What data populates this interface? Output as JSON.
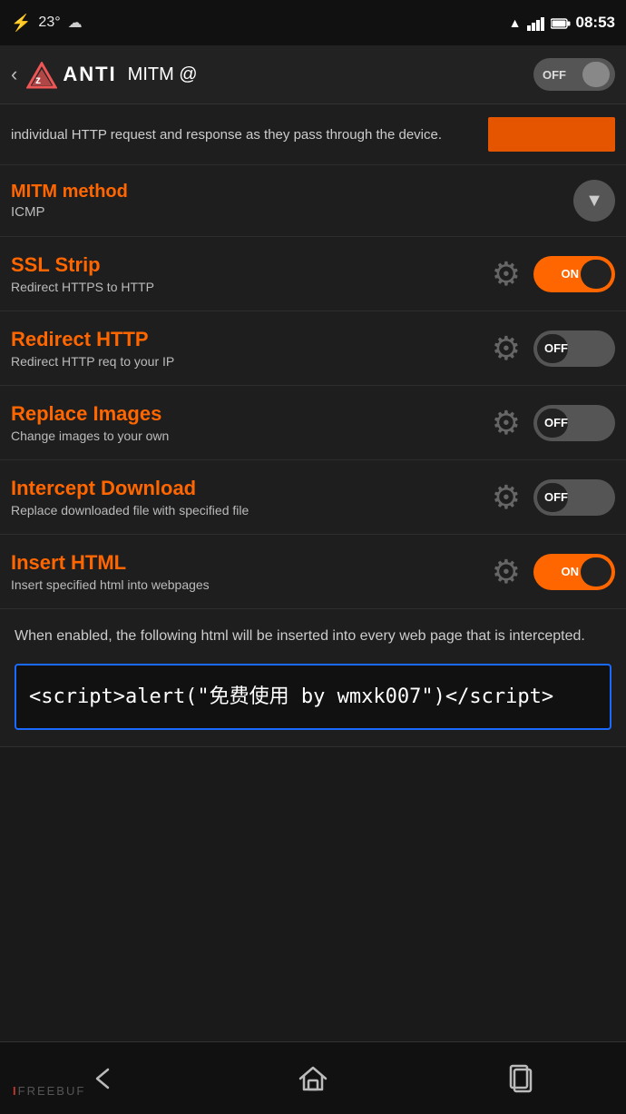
{
  "statusBar": {
    "icon": "⚡",
    "temp": "23°",
    "cloud": "☁",
    "wifi": "▲",
    "signal": "▌▌▌",
    "battery": "🔋",
    "time": "08:53"
  },
  "navBar": {
    "back": "‹",
    "logoIcon": "⟁",
    "logoText": "ANTI",
    "title": "MITM @",
    "toggleLabel": "OFF"
  },
  "descText": "individual HTTP request and response as they pass through the device.",
  "mitmMethod": {
    "title": "MITM method",
    "value": "ICMP"
  },
  "sections": [
    {
      "id": "ssl-strip",
      "title": "SSL Strip",
      "subtitle": "Redirect HTTPS to HTTP",
      "state": "on"
    },
    {
      "id": "redirect-http",
      "title": "Redirect HTTP",
      "subtitle": "Redirect HTTP req to your IP",
      "state": "off"
    },
    {
      "id": "replace-images",
      "title": "Replace Images",
      "subtitle": "Change images to your own",
      "state": "off"
    },
    {
      "id": "intercept-download",
      "title": "Intercept Download",
      "subtitle": "Replace downloaded file with specified file",
      "state": "off"
    },
    {
      "id": "insert-html",
      "title": "Insert HTML",
      "subtitle": "Insert specified html into webpages",
      "state": "on"
    }
  ],
  "htmlSection": {
    "description": "When enabled, the following html will be inserted into every web page that is intercepted.",
    "code": "<script>alert(\"免费使用 by wmxk007\")</script>"
  },
  "bottomNav": {
    "brand": "IFREEBUF"
  },
  "toggleLabels": {
    "on": "ON",
    "off": "OFF"
  }
}
